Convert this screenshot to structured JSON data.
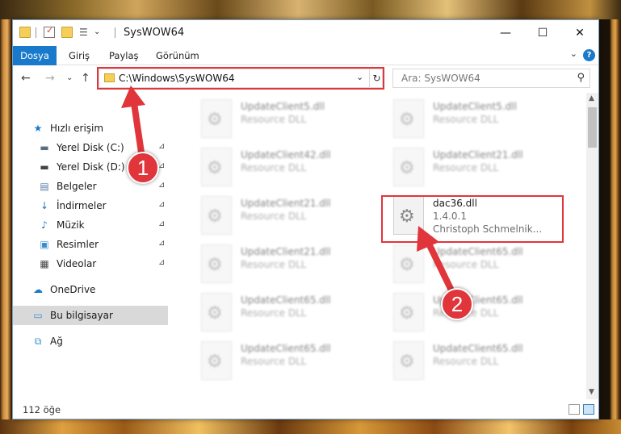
{
  "window": {
    "title": "SysWOW64",
    "minimize_glyph": "—",
    "maximize_glyph": "☐",
    "close_glyph": "✕"
  },
  "ribbon": {
    "tabs": [
      "Dosya",
      "Giriş",
      "Paylaş",
      "Görünüm"
    ],
    "help_glyph": "?",
    "expand_glyph": "⌄"
  },
  "nav": {
    "back_glyph": "←",
    "forward_glyph": "→",
    "recent_glyph": "⌄",
    "up_glyph": "↑",
    "address": "C:\\Windows\\SysWOW64",
    "address_drop_glyph": "⌄",
    "refresh_glyph": "↻",
    "search_placeholder": "Ara: SysWOW64",
    "search_glyph": "⚲"
  },
  "sidebar": {
    "items": [
      {
        "label": "Hızlı erişim",
        "icon": "star-icon",
        "glyph": "★",
        "color": "#1979ca",
        "pinned": false
      },
      {
        "label": "Yerel Disk (C:)",
        "icon": "drive-icon",
        "glyph": "▬",
        "color": "#5a6e82",
        "pinned": true
      },
      {
        "label": "Yerel Disk (D:)",
        "icon": "drive-icon",
        "glyph": "▬",
        "color": "#444444",
        "pinned": true
      },
      {
        "label": "Belgeler",
        "icon": "documents-icon",
        "glyph": "▤",
        "color": "#5a7fa8",
        "pinned": true
      },
      {
        "label": "İndirmeler",
        "icon": "download-icon",
        "glyph": "↓",
        "color": "#1979ca",
        "pinned": true
      },
      {
        "label": "Müzik",
        "icon": "music-icon",
        "glyph": "♪",
        "color": "#1979ca",
        "pinned": true
      },
      {
        "label": "Resimler",
        "icon": "pictures-icon",
        "glyph": "▣",
        "color": "#3a8fcf",
        "pinned": true
      },
      {
        "label": "Videolar",
        "icon": "videos-icon",
        "glyph": "▦",
        "color": "#444444",
        "pinned": true
      },
      {
        "label": "OneDrive",
        "icon": "onedrive-icon",
        "glyph": "☁",
        "color": "#1979ca",
        "pinned": false
      },
      {
        "label": "Bu bilgisayar",
        "icon": "computer-icon",
        "glyph": "▭",
        "color": "#3a8fcf",
        "pinned": false
      },
      {
        "label": "Ağ",
        "icon": "network-icon",
        "glyph": "⧉",
        "color": "#3a8fcf",
        "pinned": false
      }
    ],
    "pin_glyph": "📌"
  },
  "files": [
    {
      "name": "UpdateClient5.dll",
      "desc": "Resource DLL"
    },
    {
      "name": "UpdateClient5.dll",
      "desc": "Resource DLL"
    },
    {
      "name": "UpdateClient42.dll",
      "desc": "Resource DLL"
    },
    {
      "name": "UpdateClient21.dll",
      "desc": "Resource DLL"
    },
    {
      "name": "UpdateClient21.dll",
      "desc": "Resource DLL"
    },
    {
      "name": "dac36.dll",
      "version": "1.4.0.1",
      "company": "Christoph Schmelnik..."
    },
    {
      "name": "UpdateClient21.dll",
      "desc": "Resource DLL"
    },
    {
      "name": "UpdateClient65.dll",
      "desc": "Resource DLL"
    },
    {
      "name": "UpdateClient65.dll",
      "desc": "Resource DLL"
    },
    {
      "name": "UpdateClient65.dll",
      "desc": "Resource DLL"
    },
    {
      "name": "UpdateClient65.dll",
      "desc": "Resource DLL"
    },
    {
      "name": "UpdateClient65.dll",
      "desc": "Resource DLL"
    }
  ],
  "status": {
    "item_count": "112 öğe"
  },
  "annotations": {
    "badge1": "1",
    "badge2": "2",
    "color": "#e0353a"
  },
  "colors": {
    "accent": "#1979ca",
    "highlight": "#e0353a",
    "selected_bg": "#d9d9d9"
  }
}
